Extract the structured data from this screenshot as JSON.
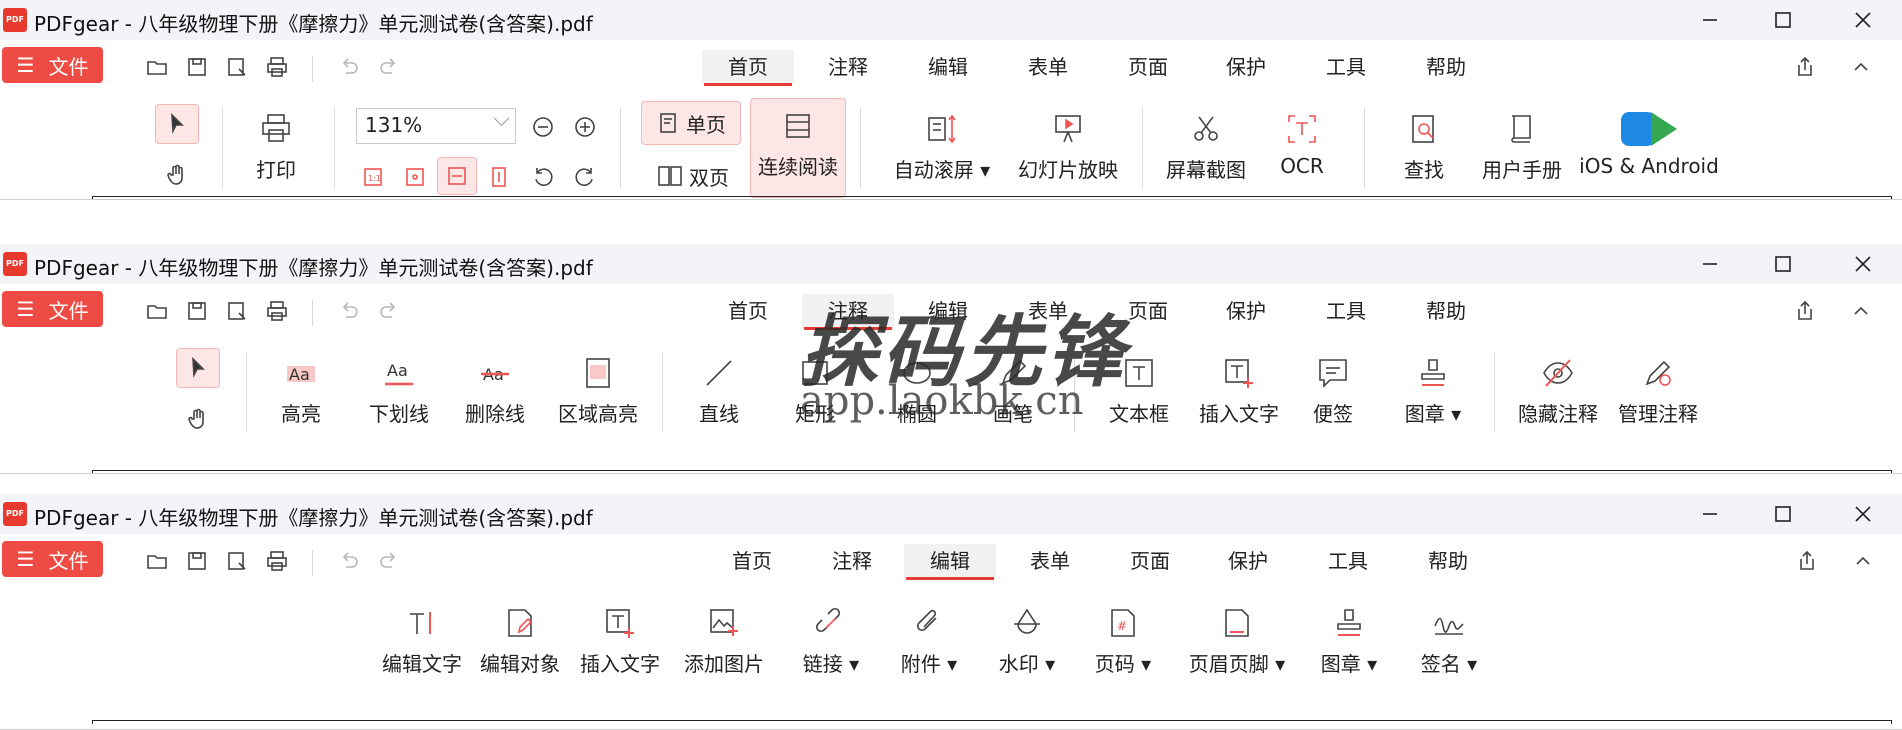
{
  "windows": [
    {
      "title": "PDFgear - 八年级物理下册《摩擦力》单元测试卷(含答案).pdf",
      "logo_text": "PDF",
      "file_label": "文件",
      "tabs": [
        "首页",
        "注释",
        "编辑",
        "表单",
        "页面",
        "保护",
        "工具",
        "帮助"
      ],
      "active_tab": "首页",
      "zoom": "131%",
      "tools": {
        "print": "打印",
        "single": "单页",
        "double": "双页",
        "continuous": "连续阅读",
        "autoscroll": "自动滚屏",
        "slideshow": "幻灯片放映",
        "screenshot": "屏幕截图",
        "ocr": "OCR",
        "find": "查找",
        "manual": "用户手册",
        "mobile": "iOS & Android"
      }
    },
    {
      "title": "PDFgear - 八年级物理下册《摩擦力》单元测试卷(含答案).pdf",
      "logo_text": "PDF",
      "file_label": "文件",
      "tabs": [
        "首页",
        "注释",
        "编辑",
        "表单",
        "页面",
        "保护",
        "工具",
        "帮助"
      ],
      "active_tab": "注释",
      "tools": {
        "highlight": "高亮",
        "underline": "下划线",
        "strike": "删除线",
        "area_highlight": "区域高亮",
        "line": "直线",
        "rect": "矩形",
        "ellipse": "椭圆",
        "pen": "画笔",
        "textbox": "文本框",
        "insert_text": "插入文字",
        "note": "便签",
        "stamp": "图章",
        "hide_annot": "隐藏注释",
        "manage_annot": "管理注释"
      }
    },
    {
      "title": "PDFgear - 八年级物理下册《摩擦力》单元测试卷(含答案).pdf",
      "logo_text": "PDF",
      "file_label": "文件",
      "tabs": [
        "首页",
        "注释",
        "编辑",
        "表单",
        "页面",
        "保护",
        "工具",
        "帮助"
      ],
      "active_tab": "编辑",
      "tools": {
        "edit_text": "编辑文字",
        "edit_object": "编辑对象",
        "insert_text": "插入文字",
        "add_image": "添加图片",
        "link": "链接",
        "attachment": "附件",
        "watermark": "水印",
        "page_number": "页码",
        "header_footer": "页眉页脚",
        "stamp": "图章",
        "sign": "签名"
      }
    }
  ],
  "watermark": {
    "title": "探码先锋",
    "url": "app.laokbk.cn"
  },
  "colors": {
    "accent": "#e63a35",
    "file_button": "#ef4b45",
    "highlight_bg": "#fde6e6"
  }
}
